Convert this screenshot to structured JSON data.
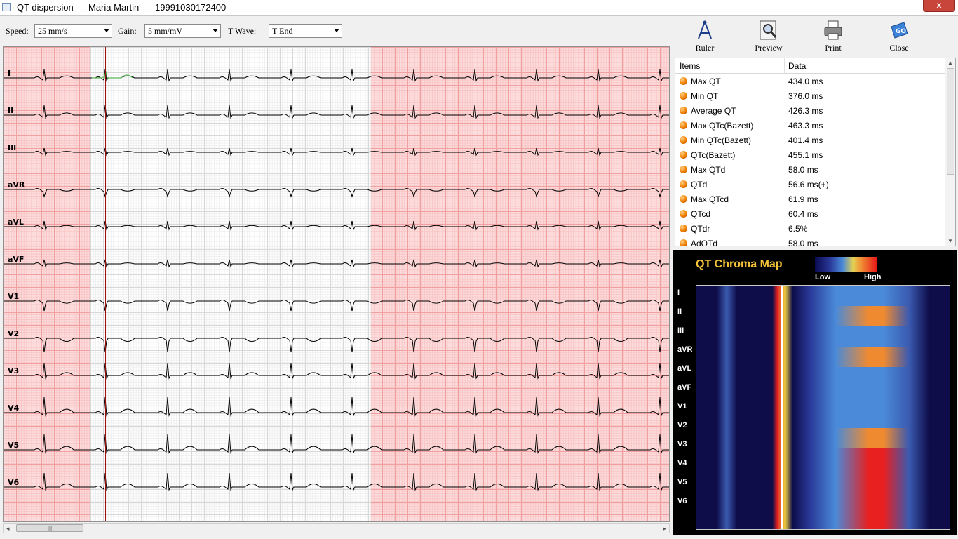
{
  "window": {
    "title": "QT dispersion",
    "patient_name": "Maria  Martin",
    "patient_id": "19991030172400",
    "close_label": "x"
  },
  "toolbar": {
    "speed_label": "Speed:",
    "speed_value": "25  mm/s",
    "gain_label": "Gain:",
    "gain_value": "5 mm/mV",
    "twave_label": "T Wave:",
    "twave_value": "T End"
  },
  "tools": [
    {
      "label": "Ruler",
      "icon": "ruler-icon"
    },
    {
      "label": "Preview",
      "icon": "preview-icon"
    },
    {
      "label": "Print",
      "icon": "print-icon"
    },
    {
      "label": "Close",
      "icon": "close-icon"
    }
  ],
  "leads": [
    "I",
    "II",
    "III",
    "aVR",
    "aVL",
    "aVF",
    "V1",
    "V2",
    "V3",
    "V4",
    "V5",
    "V6"
  ],
  "table": {
    "headers": [
      "Items",
      "Data"
    ],
    "rows": [
      {
        "item": "Max QT",
        "data": "434.0 ms"
      },
      {
        "item": "Min QT",
        "data": "376.0 ms"
      },
      {
        "item": "Average QT",
        "data": "426.3 ms"
      },
      {
        "item": "Max QTc(Bazett)",
        "data": "463.3 ms"
      },
      {
        "item": "Min QTc(Bazett)",
        "data": "401.4 ms"
      },
      {
        "item": "QTc(Bazett)",
        "data": "455.1 ms"
      },
      {
        "item": "Max QTd",
        "data": "58.0 ms"
      },
      {
        "item": "QTd",
        "data": "56.6 ms(+)"
      },
      {
        "item": "Max QTcd",
        "data": "61.9 ms"
      },
      {
        "item": "QTcd",
        "data": "60.4 ms"
      },
      {
        "item": "QTdr",
        "data": "6.5%"
      },
      {
        "item": "AdQTd",
        "data": "58.0 ms"
      }
    ]
  },
  "chroma": {
    "title": "QT Chroma Map",
    "low_label": "Low",
    "high_label": "High",
    "leads": [
      "I",
      "II",
      "III",
      "aVR",
      "aVL",
      "aVF",
      "V1",
      "V2",
      "V3",
      "V4",
      "V5",
      "V6"
    ]
  },
  "colors": {
    "grid_pink": "#fcdcdc",
    "trace_highlight": "#5cb85c",
    "marker_line": "#a01010",
    "chroma_title": "#f3c13a"
  }
}
